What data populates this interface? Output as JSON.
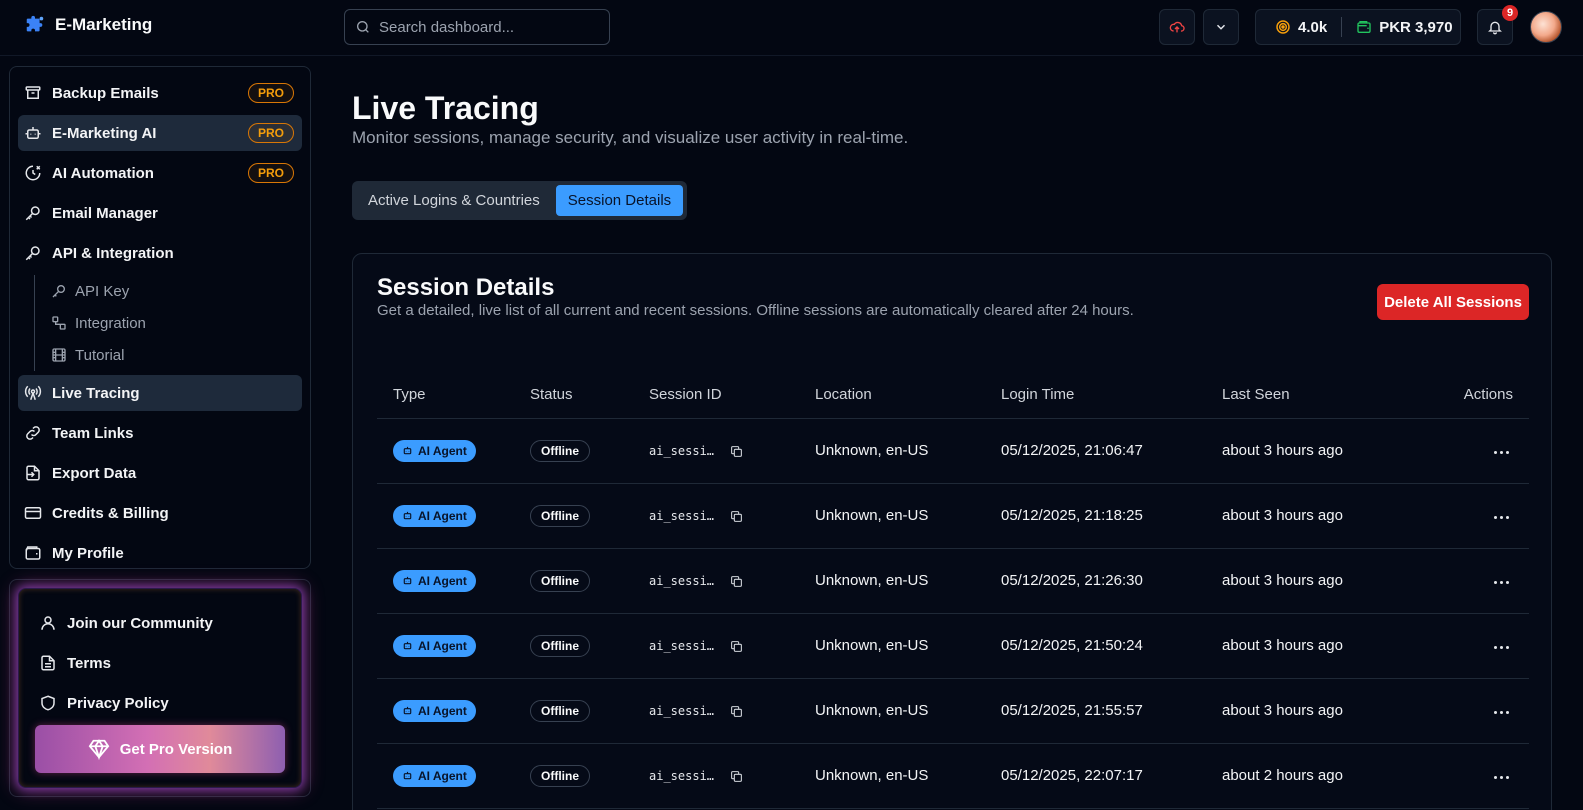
{
  "header": {
    "brand": "E-Marketing",
    "search_placeholder": "Search dashboard...",
    "credits": "4.0k",
    "balance": "PKR 3,970",
    "notification_count": "9"
  },
  "sidebar": {
    "items": [
      {
        "label": "Backup Emails",
        "badge": "PRO",
        "icon": "archive-icon"
      },
      {
        "label": "E-Marketing AI",
        "badge": "PRO",
        "icon": "bot-icon"
      },
      {
        "label": "AI Automation",
        "badge": "PRO",
        "icon": "automation-icon"
      },
      {
        "label": "Email Manager",
        "icon": "key-icon"
      },
      {
        "label": "API & Integration",
        "icon": "key-icon"
      },
      {
        "label": "Live Tracing",
        "icon": "radio-icon"
      },
      {
        "label": "Team Links",
        "icon": "link-icon"
      },
      {
        "label": "Export Data",
        "icon": "export-icon"
      },
      {
        "label": "Credits & Billing",
        "icon": "card-icon"
      },
      {
        "label": "My Profile",
        "icon": "wallet-icon"
      }
    ],
    "subitems": [
      {
        "label": "API Key",
        "icon": "key-icon"
      },
      {
        "label": "Integration",
        "icon": "workflow-icon"
      },
      {
        "label": "Tutorial",
        "icon": "film-icon"
      }
    ],
    "promo": {
      "community": "Join our Community",
      "terms": "Terms",
      "privacy": "Privacy Policy",
      "cta": "Get Pro Version"
    }
  },
  "main": {
    "title": "Live Tracing",
    "subtitle": "Monitor sessions, manage security, and visualize user activity in real-time.",
    "tabs": [
      {
        "label": "Active Logins & Countries",
        "active": false
      },
      {
        "label": "Session Details",
        "active": true
      }
    ],
    "card": {
      "title": "Session Details",
      "subtitle": "Get a detailed, live list of all current and recent sessions. Offline sessions are automatically cleared after 24 hours.",
      "delete_label": "Delete All Sessions",
      "columns": [
        "Type",
        "Status",
        "Session ID",
        "Location",
        "Login Time",
        "Last Seen",
        "Actions"
      ],
      "rows": [
        {
          "type": "AI Agent",
          "status": "Offline",
          "session_id": "ai_sessi…",
          "location": "Unknown, en-US",
          "login_time": "05/12/2025, 21:06:47",
          "last_seen": "about 3 hours ago"
        },
        {
          "type": "AI Agent",
          "status": "Offline",
          "session_id": "ai_sessi…",
          "location": "Unknown, en-US",
          "login_time": "05/12/2025, 21:18:25",
          "last_seen": "about 3 hours ago"
        },
        {
          "type": "AI Agent",
          "status": "Offline",
          "session_id": "ai_sessi…",
          "location": "Unknown, en-US",
          "login_time": "05/12/2025, 21:26:30",
          "last_seen": "about 3 hours ago"
        },
        {
          "type": "AI Agent",
          "status": "Offline",
          "session_id": "ai_sessi…",
          "location": "Unknown, en-US",
          "login_time": "05/12/2025, 21:50:24",
          "last_seen": "about 3 hours ago"
        },
        {
          "type": "AI Agent",
          "status": "Offline",
          "session_id": "ai_sessi…",
          "location": "Unknown, en-US",
          "login_time": "05/12/2025, 21:55:57",
          "last_seen": "about 3 hours ago"
        },
        {
          "type": "AI Agent",
          "status": "Offline",
          "session_id": "ai_sessi…",
          "location": "Unknown, en-US",
          "login_time": "05/12/2025, 22:07:17",
          "last_seen": "about 2 hours ago"
        }
      ]
    }
  },
  "colors": {
    "accent": "#3b9cff",
    "danger": "#dc2626",
    "pro": "#f59e0b",
    "background": "#030712"
  }
}
